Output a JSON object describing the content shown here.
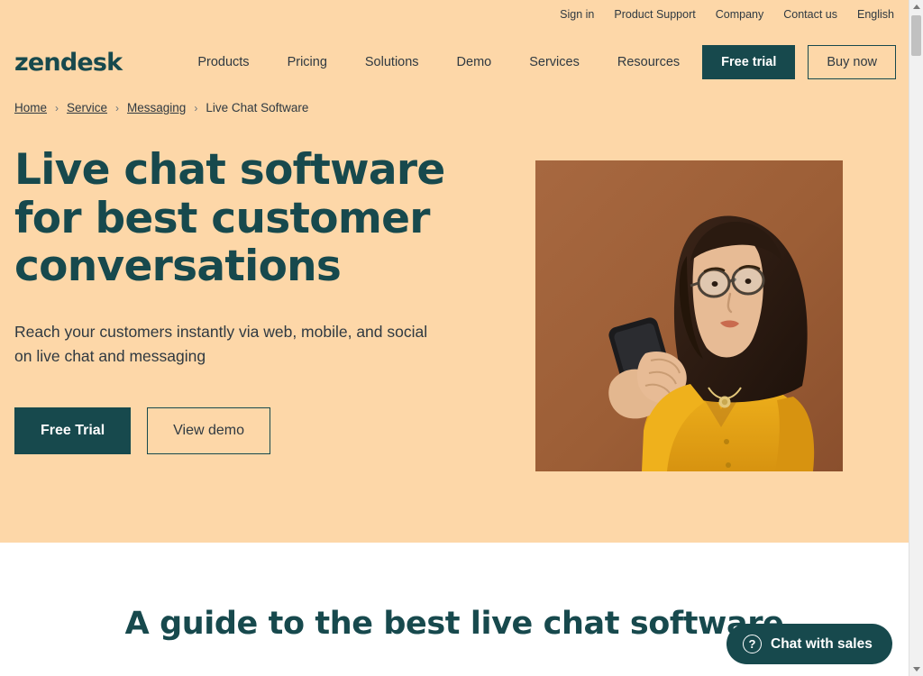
{
  "colors": {
    "hero_background": "#FDD7A8",
    "brand_dark": "#17494D",
    "text_dark": "#2f3941",
    "page_background": "#ffffff",
    "image_background": "#9C5E36",
    "shirt_yellow": "#E8A816"
  },
  "utility_nav": {
    "items": [
      {
        "label": "Sign in"
      },
      {
        "label": "Product Support"
      },
      {
        "label": "Company"
      },
      {
        "label": "Contact us"
      },
      {
        "label": "English"
      }
    ]
  },
  "header": {
    "logo": "zendesk",
    "nav": [
      {
        "label": "Products"
      },
      {
        "label": "Pricing"
      },
      {
        "label": "Solutions"
      },
      {
        "label": "Demo"
      },
      {
        "label": "Services"
      },
      {
        "label": "Resources"
      }
    ],
    "cta_primary": "Free trial",
    "cta_secondary": "Buy now"
  },
  "breadcrumb": {
    "separator": "›",
    "items": [
      {
        "label": "Home",
        "current": false
      },
      {
        "label": "Service",
        "current": false
      },
      {
        "label": "Messaging",
        "current": false
      },
      {
        "label": "Live Chat Software",
        "current": true
      }
    ]
  },
  "hero": {
    "title": "Live chat software for best customer conversations",
    "subtitle": "Reach your customers instantly via web, mobile, and social on live chat and messaging",
    "cta_primary": "Free Trial",
    "cta_secondary": "View demo",
    "image_alt": "Woman with glasses in a yellow shirt holding a smartphone against a brown background"
  },
  "guide_section": {
    "title": "A guide to the best live chat software"
  },
  "chat_widget": {
    "label": "Chat with sales",
    "icon": "question-mark-circle-icon",
    "icon_glyph": "?"
  },
  "scrollbar": {
    "up_arrow": "▲",
    "down_arrow": "▼"
  }
}
